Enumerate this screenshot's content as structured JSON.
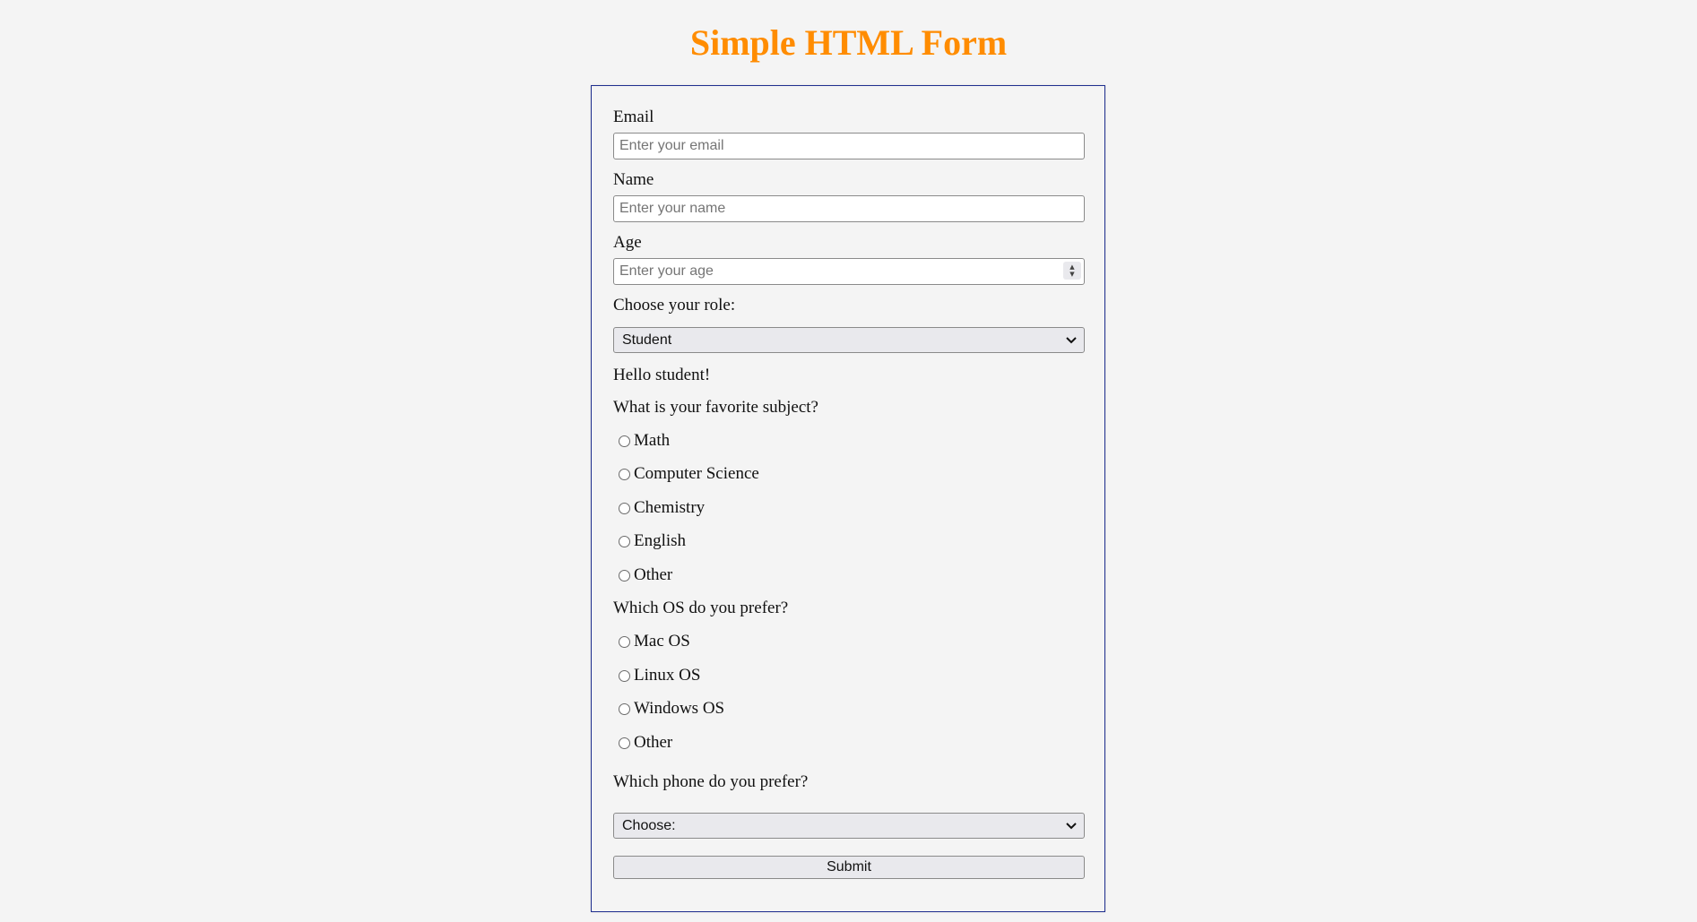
{
  "page": {
    "title": "Simple HTML Form",
    "title_color": "#ff8c00",
    "border_color": "#1f2f8f"
  },
  "form": {
    "email": {
      "label": "Email",
      "placeholder": "Enter your email",
      "value": ""
    },
    "name": {
      "label": "Name",
      "placeholder": "Enter your name",
      "value": ""
    },
    "age": {
      "label": "Age",
      "placeholder": "Enter your age",
      "value": ""
    },
    "role": {
      "label": "Choose your role:",
      "selected": "Student"
    },
    "greeting": "Hello student!",
    "subject": {
      "question": "What is your favorite subject?",
      "options": [
        "Math",
        "Computer Science",
        "Chemistry",
        "English",
        "Other"
      ]
    },
    "os": {
      "question": "Which OS do you prefer?",
      "options": [
        "Mac OS",
        "Linux OS",
        "Windows OS",
        "Other"
      ]
    },
    "phone": {
      "question": "Which phone do you prefer?",
      "selected": "Choose:"
    },
    "submit_label": "Submit"
  }
}
